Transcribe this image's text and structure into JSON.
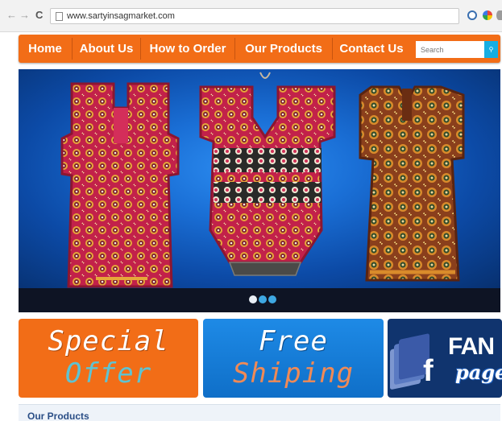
{
  "browser": {
    "url": "www.sartyinsagmarket.com",
    "back_icon": "←",
    "forward_icon": "→",
    "reload_icon": "C"
  },
  "nav": {
    "items": [
      {
        "label": "Home"
      },
      {
        "label": "About Us"
      },
      {
        "label": "How to Order"
      },
      {
        "label": "Our Products"
      },
      {
        "label": "Contact Us"
      }
    ],
    "search_placeholder": "Search",
    "search_icon": "⚲"
  },
  "slider": {
    "slide_count": 3,
    "active_slide": 1
  },
  "banners": {
    "special": {
      "line1": "Special",
      "line2": "Offer"
    },
    "shipping": {
      "line1": "Free",
      "line2": "Shiping"
    },
    "fan": {
      "icon": "f",
      "line1": "FAN",
      "line2": "page"
    }
  },
  "section": {
    "title": "Our Products"
  },
  "colors": {
    "nav_orange": "#f26d17",
    "hero_blue": "#1a6fd6",
    "fan_navy": "#10346e",
    "search_button": "#16aee3"
  }
}
